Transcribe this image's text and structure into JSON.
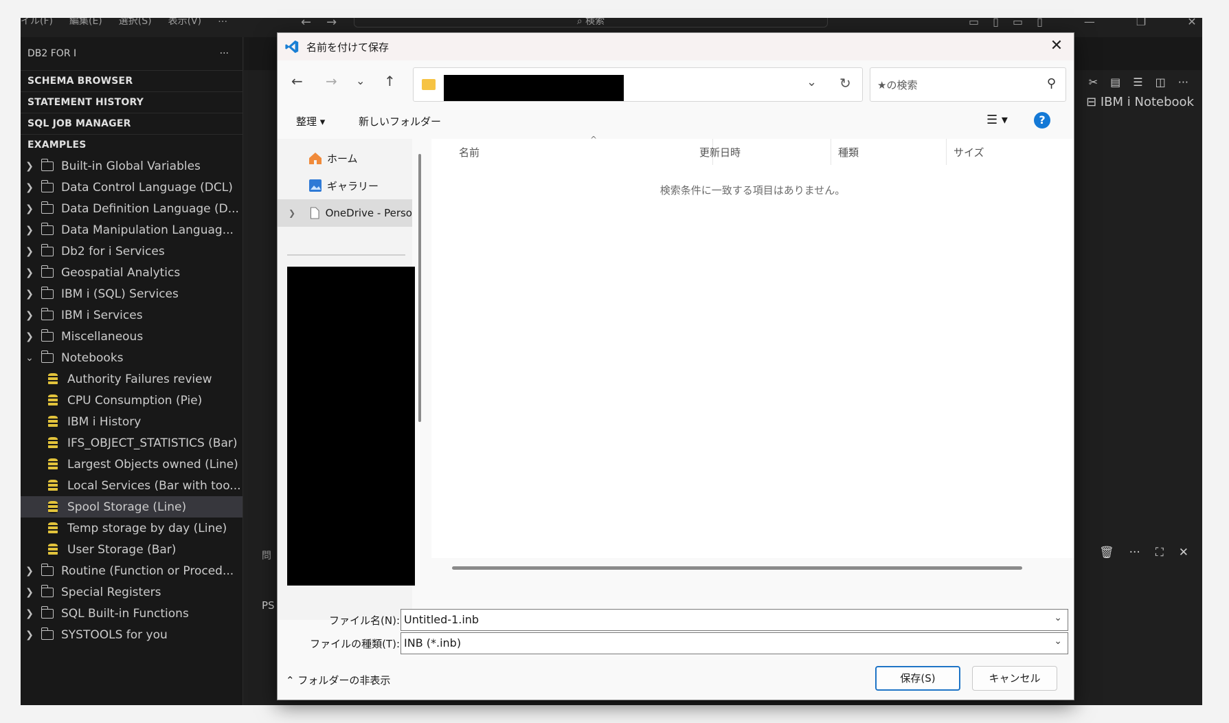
{
  "titlebar": {
    "menus": [
      "イル(F)",
      "編集(E)",
      "選択(S)",
      "表示(V)",
      "…"
    ],
    "search_placeholder": "⌕ 検索"
  },
  "sidebar": {
    "title": "DB2 FOR I",
    "more": "···",
    "sections": [
      "SCHEMA BROWSER",
      "STATEMENT HISTORY",
      "SQL JOB MANAGER",
      "EXAMPLES"
    ],
    "folders_top": [
      "Built-in Global Variables",
      "Data Control Language (DCL)",
      "Data Definition Language (D...",
      "Data Manipulation Languag...",
      "Db2 for i Services",
      "Geospatial Analytics",
      "IBM i (SQL) Services",
      "IBM i Services",
      "Miscellaneous"
    ],
    "notebooks_label": "Notebooks",
    "notebooks": [
      "Authority Failures review",
      "CPU Consumption (Pie)",
      "IBM i History",
      "IFS_OBJECT_STATISTICS (Bar)",
      "Largest Objects owned (Line)",
      "Local Services (Bar with too...",
      "Spool Storage (Line)",
      "Temp storage by day (Line)",
      "User Storage (Bar)"
    ],
    "selected_notebook": "Spool Storage (Line)",
    "folders_bottom": [
      "Routine (Function or Proced...",
      "Special Registers",
      "SQL Built-in Functions",
      "SYSTOOLS for you"
    ]
  },
  "editor": {
    "notebook_label": "IBM i Notebook",
    "panel_label": "問",
    "terminal_prompt": "PS"
  },
  "dialog": {
    "title": "名前を付けて保存",
    "search_placeholder": "★の検索",
    "organize": "整理 ▾",
    "new_folder": "新しいフォルダー",
    "nav": {
      "home": "ホーム",
      "gallery": "ギャラリー",
      "onedrive": "OneDrive - Perso"
    },
    "columns": [
      "名前",
      "更新日時",
      "種類",
      "サイズ"
    ],
    "empty_message": "検索条件に一致する項目はありません。",
    "filename_label": "ファイル名(N):",
    "filename_value": "Untitled-1.inb",
    "filetype_label": "ファイルの種類(T):",
    "filetype_value": "INB (*.inb)",
    "hide_folders": "フォルダーの非表示",
    "save": "保存(S)",
    "cancel": "キャンセル",
    "help": "?"
  },
  "colors": {
    "vscode_bg": "#1f1f1f",
    "sidebar_bg": "#181818",
    "notebook_icon": "#e2c33b",
    "dialog_bg": "#f9f9f9",
    "accent_blue": "#1e74c6"
  }
}
